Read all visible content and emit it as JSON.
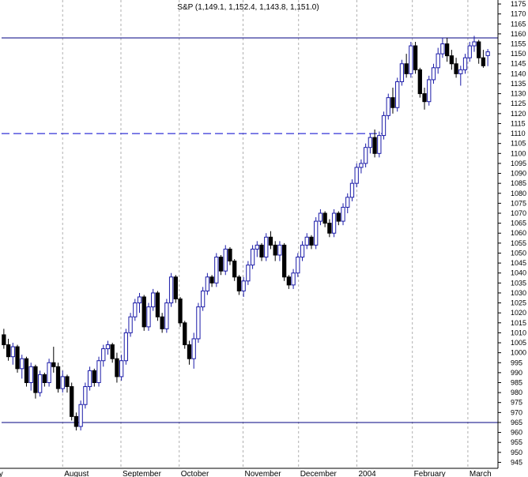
{
  "chart_data": {
    "type": "candlestick",
    "title": "S&P (1,149.1, 1,152.4, 1,143.8, 1,151.0)",
    "xlabel": "",
    "ylabel": "",
    "ylim": [
      942,
      1177
    ],
    "y_ticks": [
      945,
      950,
      955,
      960,
      965,
      970,
      975,
      980,
      985,
      990,
      995,
      1000,
      1005,
      1010,
      1015,
      1020,
      1025,
      1030,
      1035,
      1040,
      1045,
      1050,
      1055,
      1060,
      1065,
      1070,
      1075,
      1080,
      1085,
      1090,
      1095,
      1100,
      1105,
      1110,
      1115,
      1120,
      1125,
      1130,
      1135,
      1140,
      1145,
      1150,
      1155,
      1160,
      1165,
      1170,
      1175
    ],
    "y_axis_position": "right",
    "grid": "vertical dashed at month starts",
    "x_labels": [
      "July",
      "August",
      "September",
      "October",
      "November",
      "December",
      "2004",
      "February",
      "March"
    ],
    "x_label_days": [
      0,
      22,
      43,
      64,
      87,
      107,
      128,
      148,
      168
    ],
    "total_days": 176,
    "horizontal_lines": [
      {
        "value": 1158,
        "style": "solid",
        "color": "#000080",
        "from_day": 0,
        "to_day": 176
      },
      {
        "value": 965,
        "style": "solid",
        "color": "#000080",
        "from_day": 0,
        "to_day": 176
      },
      {
        "value": 1110,
        "style": "dashed",
        "color": "#0000cc",
        "from_day": 0,
        "to_day": 138
      }
    ],
    "up_color": "#1a1aa8",
    "down_color": "#000000",
    "candles": [
      [
        1009,
        1012,
        1002,
        1004
      ],
      [
        1004,
        1007,
        996,
        998
      ],
      [
        998,
        1005,
        994,
        1003
      ],
      [
        1003,
        1004,
        990,
        992
      ],
      [
        992,
        999,
        987,
        997
      ],
      [
        997,
        998,
        983,
        985
      ],
      [
        985,
        995,
        981,
        993
      ],
      [
        993,
        994,
        977,
        980
      ],
      [
        980,
        991,
        978,
        989
      ],
      [
        989,
        990,
        983,
        985
      ],
      [
        985,
        997,
        983,
        995
      ],
      [
        995,
        1003,
        990,
        993
      ],
      [
        993,
        995,
        980,
        982
      ],
      [
        982,
        991,
        980,
        988
      ],
      [
        988,
        989,
        980,
        983
      ],
      [
        983,
        985,
        966,
        968
      ],
      [
        968,
        970,
        961,
        963
      ],
      [
        963,
        976,
        961,
        974
      ],
      [
        974,
        985,
        972,
        983
      ],
      [
        983,
        993,
        981,
        991
      ],
      [
        991,
        992,
        983,
        985
      ],
      [
        985,
        998,
        983,
        996
      ],
      [
        996,
        1004,
        993,
        1002
      ],
      [
        1002,
        1006,
        999,
        1004
      ],
      [
        1004,
        1005,
        995,
        997
      ],
      [
        997,
        1000,
        985,
        988
      ],
      [
        988,
        999,
        986,
        996
      ],
      [
        996,
        1012,
        994,
        1010
      ],
      [
        1010,
        1020,
        1008,
        1018
      ],
      [
        1018,
        1027,
        1016,
        1025
      ],
      [
        1025,
        1030,
        1020,
        1028
      ],
      [
        1028,
        1029,
        1011,
        1013
      ],
      [
        1013,
        1025,
        1011,
        1023
      ],
      [
        1023,
        1032,
        1021,
        1030
      ],
      [
        1030,
        1031,
        1016,
        1018
      ],
      [
        1018,
        1020,
        1010,
        1012
      ],
      [
        1012,
        1027,
        1010,
        1025
      ],
      [
        1025,
        1040,
        1023,
        1038
      ],
      [
        1038,
        1039,
        1025,
        1027
      ],
      [
        1027,
        1028,
        1013,
        1015
      ],
      [
        1015,
        1016,
        1002,
        1004
      ],
      [
        1004,
        1006,
        994,
        997
      ],
      [
        997,
        1010,
        992,
        1007
      ],
      [
        1007,
        1025,
        1005,
        1023
      ],
      [
        1023,
        1033,
        1021,
        1031
      ],
      [
        1031,
        1040,
        1029,
        1038
      ],
      [
        1038,
        1039,
        1033,
        1035
      ],
      [
        1035,
        1050,
        1033,
        1048
      ],
      [
        1048,
        1049,
        1039,
        1041
      ],
      [
        1041,
        1054,
        1039,
        1052
      ],
      [
        1052,
        1053,
        1044,
        1046
      ],
      [
        1046,
        1047,
        1036,
        1038
      ],
      [
        1038,
        1039,
        1029,
        1031
      ],
      [
        1031,
        1038,
        1028,
        1036
      ],
      [
        1036,
        1046,
        1034,
        1044
      ],
      [
        1044,
        1054,
        1042,
        1052
      ],
      [
        1052,
        1056,
        1048,
        1054
      ],
      [
        1054,
        1055,
        1046,
        1048
      ],
      [
        1048,
        1060,
        1046,
        1058
      ],
      [
        1058,
        1061,
        1052,
        1054
      ],
      [
        1054,
        1056,
        1046,
        1049
      ],
      [
        1049,
        1056,
        1046,
        1054
      ],
      [
        1054,
        1055,
        1036,
        1038
      ],
      [
        1038,
        1039,
        1032,
        1034
      ],
      [
        1034,
        1042,
        1032,
        1040
      ],
      [
        1040,
        1050,
        1038,
        1048
      ],
      [
        1048,
        1056,
        1046,
        1054
      ],
      [
        1054,
        1060,
        1052,
        1058
      ],
      [
        1058,
        1059,
        1052,
        1054
      ],
      [
        1054,
        1068,
        1052,
        1066
      ],
      [
        1066,
        1072,
        1064,
        1070
      ],
      [
        1070,
        1071,
        1063,
        1065
      ],
      [
        1065,
        1067,
        1058,
        1060
      ],
      [
        1060,
        1072,
        1058,
        1070
      ],
      [
        1070,
        1071,
        1064,
        1066
      ],
      [
        1066,
        1075,
        1064,
        1073
      ],
      [
        1073,
        1080,
        1070,
        1078
      ],
      [
        1078,
        1087,
        1076,
        1085
      ],
      [
        1085,
        1095,
        1083,
        1093
      ],
      [
        1093,
        1097,
        1090,
        1095
      ],
      [
        1095,
        1105,
        1093,
        1103
      ],
      [
        1103,
        1110,
        1100,
        1108
      ],
      [
        1108,
        1112,
        1098,
        1100
      ],
      [
        1100,
        1111,
        1098,
        1109
      ],
      [
        1109,
        1121,
        1107,
        1119
      ],
      [
        1119,
        1130,
        1117,
        1128
      ],
      [
        1128,
        1133,
        1120,
        1123
      ],
      [
        1123,
        1138,
        1121,
        1136
      ],
      [
        1136,
        1147,
        1134,
        1145
      ],
      [
        1145,
        1150,
        1138,
        1140
      ],
      [
        1140,
        1156,
        1138,
        1154
      ],
      [
        1154,
        1156,
        1140,
        1142
      ],
      [
        1142,
        1143,
        1128,
        1130
      ],
      [
        1130,
        1133,
        1122,
        1126
      ],
      [
        1126,
        1139,
        1124,
        1137
      ],
      [
        1137,
        1145,
        1135,
        1143
      ],
      [
        1143,
        1153,
        1140,
        1150
      ],
      [
        1150,
        1158,
        1148,
        1155
      ],
      [
        1155,
        1158,
        1146,
        1149
      ],
      [
        1149,
        1152,
        1142,
        1145
      ],
      [
        1145,
        1148,
        1138,
        1140
      ],
      [
        1140,
        1144,
        1134,
        1142
      ],
      [
        1142,
        1150,
        1140,
        1148
      ],
      [
        1148,
        1156,
        1146,
        1154
      ],
      [
        1154,
        1159,
        1151,
        1156
      ],
      [
        1156,
        1157,
        1145,
        1148
      ],
      [
        1148,
        1152,
        1143,
        1144
      ],
      [
        1149.1,
        1152.4,
        1143.8,
        1151.0
      ]
    ]
  }
}
